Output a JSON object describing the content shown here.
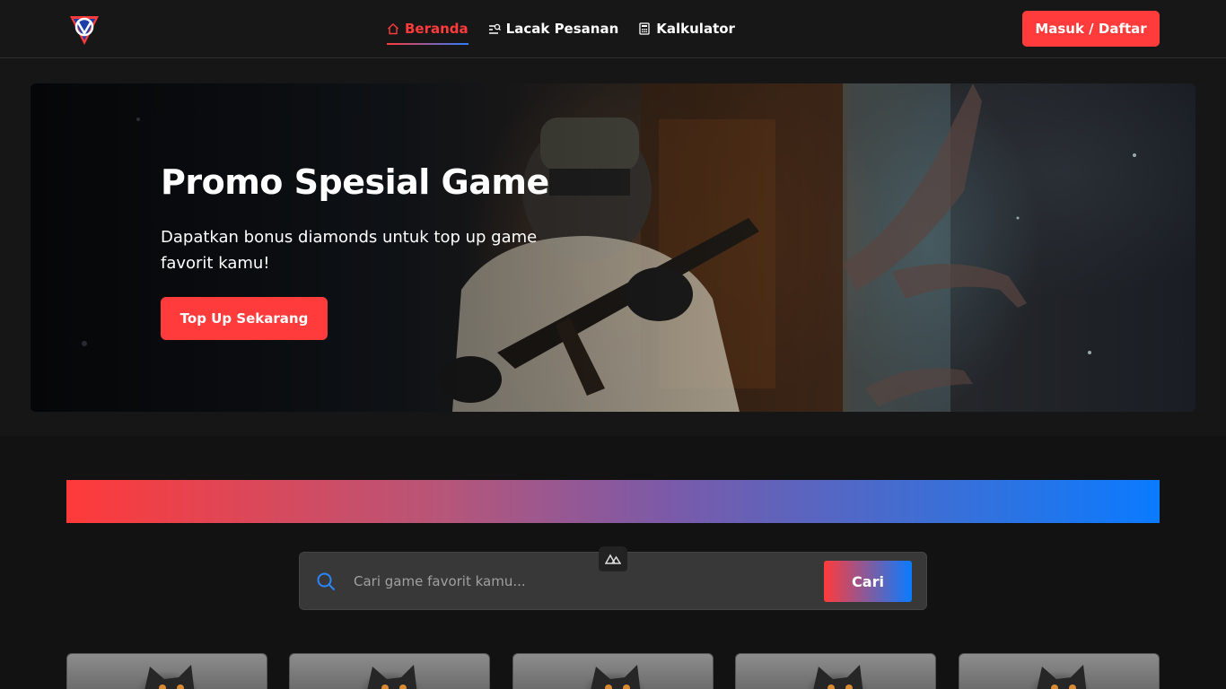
{
  "navbar": {
    "logo": "brand-logo",
    "links": [
      {
        "label": "Beranda",
        "icon": "home-icon",
        "active": true
      },
      {
        "label": "Lacak Pesanan",
        "icon": "list-search-icon",
        "active": false
      },
      {
        "label": "Kalkulator",
        "icon": "calculator-icon",
        "active": false
      }
    ],
    "login_label": "Masuk / Daftar"
  },
  "hero": {
    "title": "Promo Spesial Game",
    "subtitle": "Dapatkan bonus diamonds untuk top up game favorit kamu!",
    "cta_label": "Top Up Sekarang"
  },
  "search": {
    "placeholder": "Cari game favorit kamu...",
    "value": "",
    "button_label": "Cari"
  },
  "game_cards": [
    {
      "image": "cat-image"
    },
    {
      "image": "cat-image"
    },
    {
      "image": "cat-image"
    },
    {
      "image": "cat-image"
    },
    {
      "image": "cat-image"
    }
  ],
  "colors": {
    "accent": "#ff3b3b",
    "secondary": "#0a7bff",
    "background": "#121212"
  }
}
